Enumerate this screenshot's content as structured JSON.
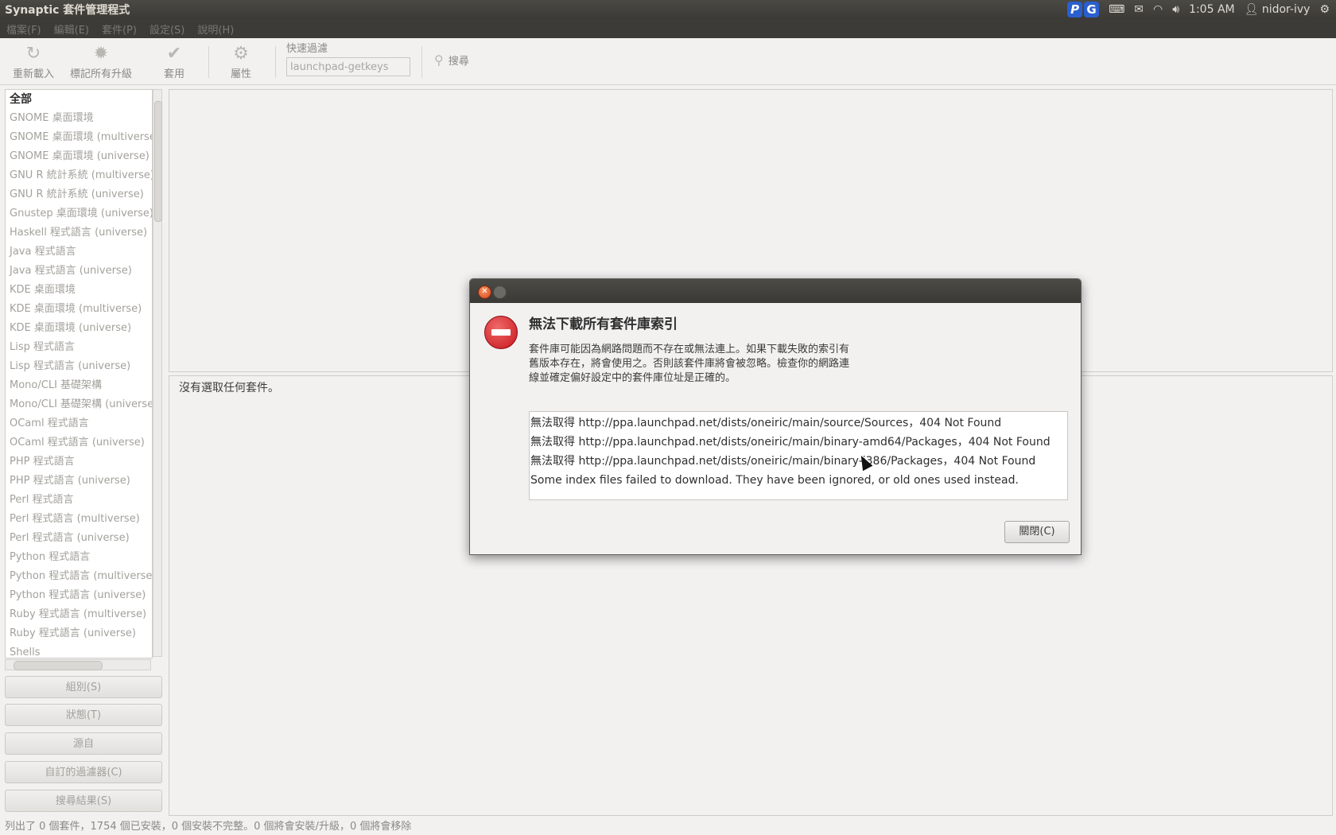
{
  "topbar": {
    "title": "Synaptic 套件管理程式",
    "indicators": {
      "p_badge": "P",
      "g_badge": "G",
      "time": "1:05 AM",
      "user": "nidor-ivy"
    }
  },
  "menubar": [
    "檔案(F)",
    "編輯(E)",
    "套件(P)",
    "設定(S)",
    "說明(H)"
  ],
  "toolbar": {
    "reload": "重新載入",
    "mark_all": "標記所有升級",
    "apply": "套用",
    "properties": "屬性",
    "quickfilter_label": "快速過濾",
    "quickfilter_value": "launchpad-getkeys",
    "search": "搜尋"
  },
  "sidebar": {
    "categories": [
      "全部",
      "GNOME 桌面環境",
      "GNOME 桌面環境 (multiverse)",
      "GNOME 桌面環境 (universe)",
      "GNU R 統計系統 (multiverse)",
      "GNU R 統計系統 (universe)",
      "Gnustep 桌面環境 (universe)",
      "Haskell 程式語言 (universe)",
      "Java 程式語言",
      "Java 程式語言 (universe)",
      "KDE 桌面環境",
      "KDE 桌面環境 (multiverse)",
      "KDE 桌面環境 (universe)",
      "Lisp 程式語言",
      "Lisp 程式語言 (universe)",
      "Mono/CLI 基礎架構",
      "Mono/CLI 基礎架構 (universe)",
      "OCaml 程式語言",
      "OCaml 程式語言 (universe)",
      "PHP 程式語言",
      "PHP 程式語言 (universe)",
      "Perl 程式語言",
      "Perl 程式語言 (multiverse)",
      "Perl 程式語言 (universe)",
      "Python 程式語言",
      "Python 程式語言 (multiverse)",
      "Python 程式語言 (universe)",
      "Ruby 程式語言 (multiverse)",
      "Ruby 程式語言 (universe)",
      "Shells"
    ],
    "buttons": [
      "組別(S)",
      "狀態(T)",
      "源自",
      "自訂的過濾器(C)",
      "搜尋結果(S)"
    ]
  },
  "details": {
    "empty_text": "沒有選取任何套件。"
  },
  "statusbar": "列出了 0 個套件，1754 個已安裝，0 個安裝不完整。0 個將會安裝/升級，0 個將會移除",
  "dialog": {
    "heading": "無法下載所有套件庫索引",
    "body": "套件庫可能因為網路問題而不存在或無法連上。如果下載失敗的索引有舊版本存在，將會使用之。否則該套件庫將會被忽略。檢查你的網路連線並確定偏好設定中的套件庫位址是正確的。",
    "details": [
      "無法取得 http://ppa.launchpad.net/dists/oneiric/main/source/Sources，404  Not Found",
      "無法取得 http://ppa.launchpad.net/dists/oneiric/main/binary-amd64/Packages，404  Not Found",
      "無法取得 http://ppa.launchpad.net/dists/oneiric/main/binary-i386/Packages，404  Not Found",
      "Some index files failed to download. They have been ignored, or old ones used instead."
    ],
    "close_button": "關閉(C)"
  },
  "colors": {
    "panel": "#3c3b37",
    "error_red": "#c6141b",
    "window_bg": "#f2f1f0"
  }
}
